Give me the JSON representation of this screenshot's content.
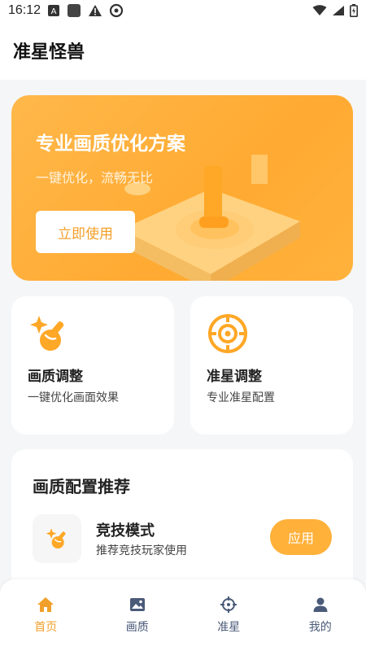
{
  "status_bar": {
    "time": "16:12",
    "left_icons": [
      "text-a-icon",
      "app-square-icon",
      "warning-icon",
      "sync-icon"
    ],
    "right_icons": [
      "wifi-icon",
      "signal-icon",
      "battery-icon"
    ]
  },
  "header": {
    "title": "准星怪兽"
  },
  "banner": {
    "title": "专业画质优化方案",
    "subtitle": "一键优化，流畅无比",
    "button_label": "立即使用",
    "color": "#ffaa32"
  },
  "features": [
    {
      "title": "画质调整",
      "subtitle": "一键优化画面效果",
      "icon": "brush-icon"
    },
    {
      "title": "准星调整",
      "subtitle": "专业准星配置",
      "icon": "crosshair-icon"
    }
  ],
  "recommend": {
    "title": "画质配置推荐",
    "mode_name": "竞技模式",
    "mode_desc": "推荐竞技玩家使用",
    "apply_label": "应用",
    "mode_icon": "brush-icon"
  },
  "bottom_nav": {
    "items": [
      {
        "label": "首页",
        "icon": "home-icon",
        "active": true
      },
      {
        "label": "画质",
        "icon": "image-icon",
        "active": false
      },
      {
        "label": "准星",
        "icon": "crosshair-icon",
        "active": false
      },
      {
        "label": "我的",
        "icon": "user-icon",
        "active": false
      }
    ]
  },
  "colors": {
    "accent": "#ffb13a",
    "nav_active": "#f0a02a",
    "nav_inactive": "#4a5a78"
  }
}
